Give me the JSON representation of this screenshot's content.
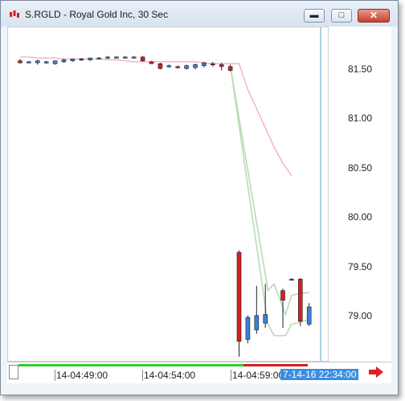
{
  "window": {
    "title": "S.RGLD - Royal Gold Inc, 30 Sec",
    "minimize_glyph": "▬",
    "maximize_glyph": "□",
    "close_glyph": "✕"
  },
  "colors": {
    "up_candle": "#3a7fd8",
    "down_candle": "#d42020",
    "band_line": "#b8dcb8",
    "ma_line": "#f4a0c8",
    "cursor_line": "#5aa0c8",
    "cursor_label_bg": "#3a8ee0",
    "arrow": "#e02020"
  },
  "y_axis": {
    "labels": [
      "81.50",
      "81.00",
      "80.50",
      "80.00",
      "79.50",
      "79.00"
    ]
  },
  "x_axis": {
    "labels": [
      "14-04:49:00",
      "14-04:54:00",
      "14-04:59:00"
    ],
    "cursor_label": "7-14-16 22:34:00"
  },
  "chart_data": {
    "type": "candlestick",
    "ylim": [
      78.6,
      82.1
    ],
    "candles": [
      {
        "o": 81.75,
        "h": 81.77,
        "l": 81.72,
        "c": 81.73
      },
      {
        "o": 81.74,
        "h": 81.75,
        "l": 81.73,
        "c": 81.74
      },
      {
        "o": 81.73,
        "h": 81.76,
        "l": 81.71,
        "c": 81.75
      },
      {
        "o": 81.74,
        "h": 81.75,
        "l": 81.72,
        "c": 81.74
      },
      {
        "o": 81.72,
        "h": 81.75,
        "l": 81.71,
        "c": 81.75
      },
      {
        "o": 81.74,
        "h": 81.77,
        "l": 81.73,
        "c": 81.76
      },
      {
        "o": 81.75,
        "h": 81.77,
        "l": 81.74,
        "c": 81.77
      },
      {
        "o": 81.77,
        "h": 81.78,
        "l": 81.75,
        "c": 81.76
      },
      {
        "o": 81.76,
        "h": 81.78,
        "l": 81.75,
        "c": 81.78
      },
      {
        "o": 81.78,
        "h": 81.79,
        "l": 81.77,
        "c": 81.78
      },
      {
        "o": 81.78,
        "h": 81.8,
        "l": 81.77,
        "c": 81.79
      },
      {
        "o": 81.79,
        "h": 81.8,
        "l": 81.78,
        "c": 81.79
      },
      {
        "o": 81.79,
        "h": 81.8,
        "l": 81.78,
        "c": 81.79
      },
      {
        "o": 81.79,
        "h": 81.8,
        "l": 81.78,
        "c": 81.79
      },
      {
        "o": 81.79,
        "h": 81.8,
        "l": 81.74,
        "c": 81.75
      },
      {
        "o": 81.74,
        "h": 81.75,
        "l": 81.72,
        "c": 81.72
      },
      {
        "o": 81.72,
        "h": 81.73,
        "l": 81.66,
        "c": 81.67
      },
      {
        "o": 81.69,
        "h": 81.71,
        "l": 81.68,
        "c": 81.7
      },
      {
        "o": 81.69,
        "h": 81.7,
        "l": 81.67,
        "c": 81.68
      },
      {
        "o": 81.67,
        "h": 81.71,
        "l": 81.66,
        "c": 81.7
      },
      {
        "o": 81.68,
        "h": 81.72,
        "l": 81.66,
        "c": 81.71
      },
      {
        "o": 81.7,
        "h": 81.74,
        "l": 81.68,
        "c": 81.73
      },
      {
        "o": 81.72,
        "h": 81.74,
        "l": 81.69,
        "c": 81.71
      },
      {
        "o": 81.71,
        "h": 81.73,
        "l": 81.65,
        "c": 81.69
      },
      {
        "o": 81.69,
        "h": 81.71,
        "l": 81.64,
        "c": 81.65
      },
      {
        "o": 79.75,
        "h": 79.77,
        "l": 78.66,
        "c": 78.82
      },
      {
        "o": 78.84,
        "h": 79.09,
        "l": 78.8,
        "c": 79.07
      },
      {
        "o": 78.94,
        "h": 79.4,
        "l": 78.9,
        "c": 79.09
      },
      {
        "o": 79.01,
        "h": 79.42,
        "l": 78.96,
        "c": 79.1
      },
      {
        "o": 79.35,
        "h": 79.37,
        "l": 78.96,
        "c": 79.25
      },
      {
        "o": 79.47,
        "h": 79.48,
        "l": 79.46,
        "c": 79.47
      },
      {
        "o": 79.47,
        "h": 79.48,
        "l": 78.98,
        "c": 79.03
      },
      {
        "o": 79.0,
        "h": 79.22,
        "l": 78.98,
        "c": 79.18
      }
    ],
    "slots": [
      0,
      1,
      2,
      3,
      4,
      5,
      6,
      7,
      8,
      9,
      10,
      11,
      12,
      13,
      14,
      15,
      16,
      17,
      18,
      19,
      20,
      21,
      22,
      23,
      24,
      25,
      26,
      27,
      28,
      30,
      31,
      32,
      33
    ],
    "ma_line": [
      81.79,
      81.79,
      81.78,
      81.78,
      81.78,
      81.77,
      81.77,
      81.77,
      81.77,
      81.77,
      81.76,
      81.76,
      81.75,
      81.74,
      81.74,
      81.74,
      81.74,
      81.74,
      81.74,
      81.74,
      81.74,
      81.73,
      81.72,
      81.72,
      81.72,
      81.72,
      81.45,
      81.25,
      81.05,
      80.85,
      80.68,
      80.55
    ],
    "band_upper": [
      81.7,
      79.35,
      79.42,
      79.1,
      79.3,
      79.32,
      79.33
    ],
    "band_lower": [
      81.7,
      79.0,
      78.88,
      78.88,
      79.0,
      79.02,
      79.05
    ]
  }
}
